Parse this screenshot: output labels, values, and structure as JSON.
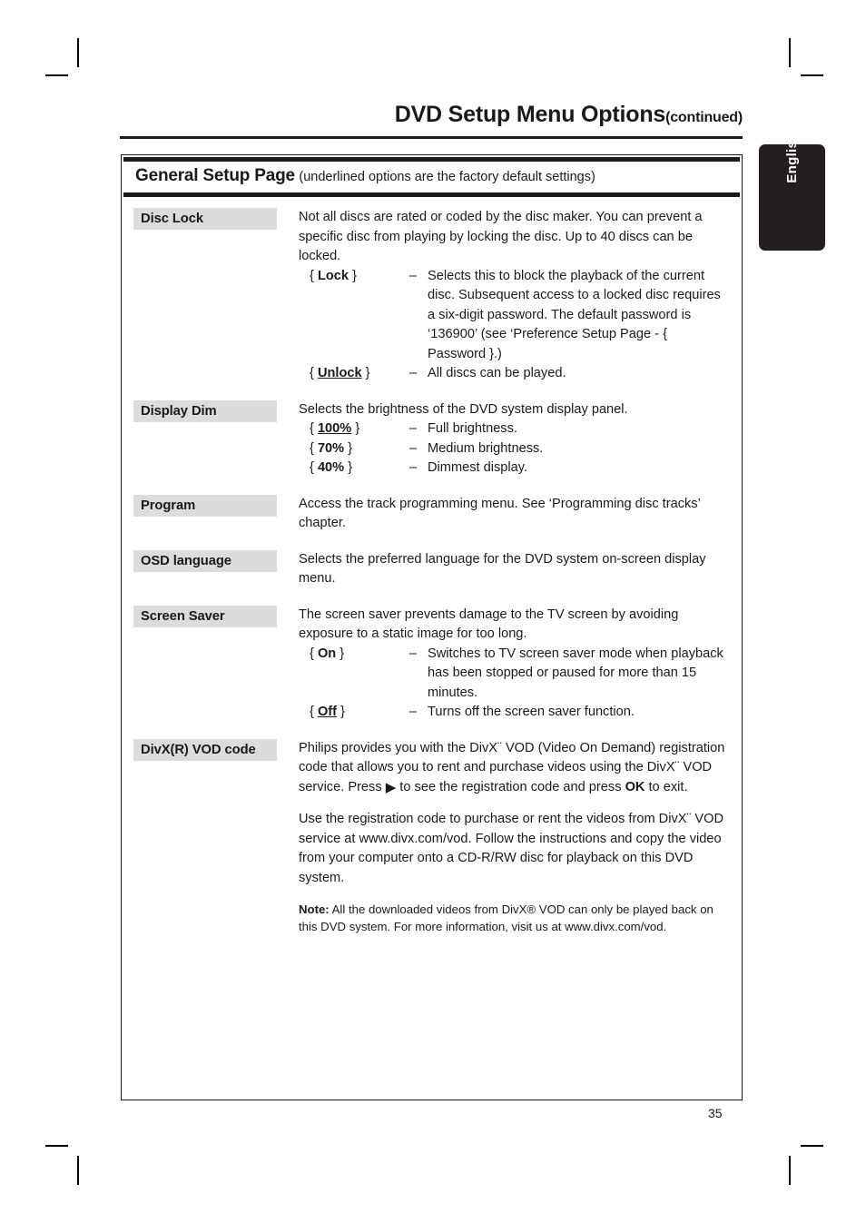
{
  "header": {
    "title": "DVD Setup Menu Options",
    "title_suffix": "(continued)"
  },
  "side_tab": {
    "language_label": "English"
  },
  "section": {
    "title": "General Setup Page",
    "note": "(underlined options are the factory default settings)"
  },
  "footer": {
    "page_number": "35"
  },
  "rows": {
    "disc_lock": {
      "label": "Disc Lock",
      "intro": "Not all discs are rated or coded by the disc maker.  You can prevent a specific disc from playing by locking the disc.  Up to 40 discs can be locked.",
      "option_lock_key_open": "{ ",
      "option_lock_key": "Lock",
      "option_lock_key_close": " }",
      "option_lock_dash": "–",
      "option_lock_desc_1": "Selects this to block the playback of the current disc.  Subsequent access to a locked disc requires a six-digit password.  The default password is ‘136900’ (see ‘Preference Setup Page - { Password }.)",
      "option_unlock_key": "Unlock",
      "option_unlock_dash": "–",
      "option_unlock_desc": "All discs can be played."
    },
    "display_dim": {
      "label": "Display Dim",
      "intro": "Selects the brightness of the DVD system display panel.",
      "options": [
        {
          "key": "100%",
          "underlined": true,
          "dash": "–",
          "desc": "Full brightness."
        },
        {
          "key": "70%",
          "underlined": false,
          "dash": "–",
          "desc": "Medium brightness."
        },
        {
          "key": "40%",
          "underlined": false,
          "dash": "–",
          "desc": "Dimmest display."
        }
      ]
    },
    "program": {
      "label": "Program",
      "intro": "Access the track programming menu.  See ‘Programming disc tracks’ chapter."
    },
    "osd_language": {
      "label": "OSD language",
      "intro": "Selects the preferred language for the DVD system on-screen display menu."
    },
    "screen_saver": {
      "label": "Screen Saver",
      "intro": "The screen saver prevents damage to the TV screen by avoiding exposure to a static image for too long.",
      "option_on_key": "On",
      "option_on_dash": "–",
      "option_on_desc": "Switches to TV screen saver mode when playback has been stopped or paused for more than 15 minutes.",
      "option_off_key": "Off",
      "option_off_dash": "–",
      "option_off_desc": "Turns off the screen saver function."
    },
    "divx_vod": {
      "label": "DivX(R) VOD code",
      "para1_a": "Philips provides you with the DivX",
      "para1_tm": "¨",
      "para1_b": " VOD (Video On Demand) registration code that allows you to rent and purchase videos using the DivX",
      "para1_c": " VOD service.  Press ",
      "para1_arrow": "▶",
      "para1_d": " to see the registration code and press ",
      "para1_ok": "OK",
      "para1_e": " to exit.",
      "para2_a": "Use the registration code to purchase or rent the videos from DivX",
      "para2_b": " VOD service at www.divx.com/vod.  Follow the instructions and copy the video from your computer onto a CD-R/RW disc for playback on this DVD system.",
      "note_label": "Note:",
      "note_text": "  All the downloaded videos from DivX® VOD can only be played back on this DVD system.  For more information, visit us at www.divx.com/vod."
    }
  },
  "braces": {
    "open": "{",
    "close": "}"
  }
}
